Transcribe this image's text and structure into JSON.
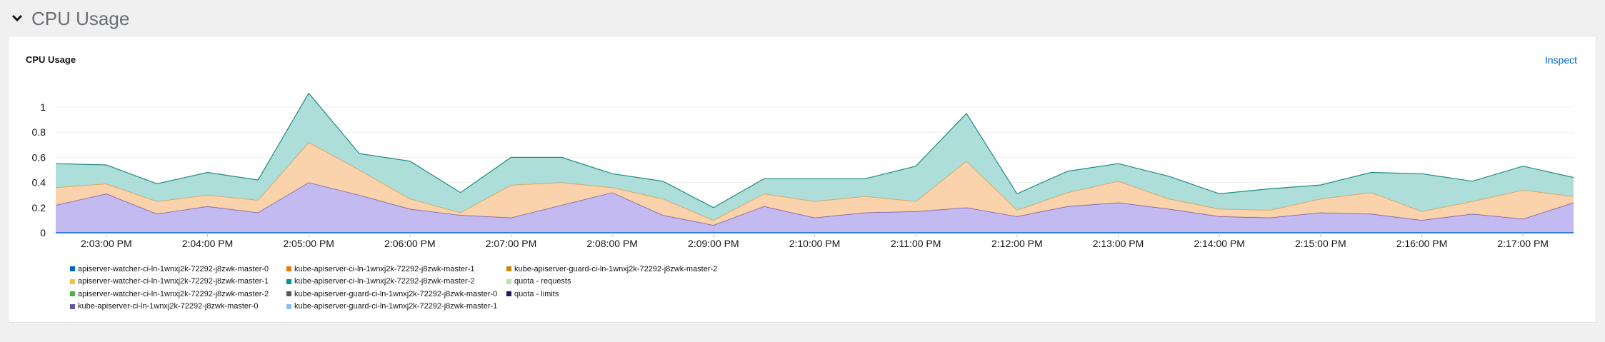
{
  "section": {
    "title": "CPU Usage"
  },
  "card": {
    "title": "CPU Usage",
    "inspect_label": "Inspect"
  },
  "chart_data": {
    "type": "area",
    "stacked": true,
    "x": [
      "14:02:30",
      "14:03:00",
      "14:03:30",
      "14:04:00",
      "14:04:30",
      "14:05:00",
      "14:05:30",
      "14:06:00",
      "14:06:30",
      "14:07:00",
      "14:07:30",
      "14:08:00",
      "14:08:30",
      "14:09:00",
      "14:09:30",
      "14:10:00",
      "14:10:30",
      "14:11:00",
      "14:11:30",
      "14:12:00",
      "14:12:30",
      "14:13:00",
      "14:13:30",
      "14:14:00",
      "14:14:30",
      "14:15:00",
      "14:15:30",
      "14:16:00",
      "14:16:30",
      "14:17:00",
      "14:17:30"
    ],
    "series": [
      {
        "name": "kube-apiserver-ci-ln-1wnxj2k-72292-j8zwk-master-0",
        "color": "#b8aeee",
        "stroke": "#6753ac",
        "values": [
          0.22,
          0.31,
          0.15,
          0.21,
          0.16,
          0.4,
          0.3,
          0.19,
          0.14,
          0.12,
          0.22,
          0.32,
          0.14,
          0.06,
          0.21,
          0.12,
          0.16,
          0.17,
          0.2,
          0.13,
          0.21,
          0.24,
          0.19,
          0.13,
          0.12,
          0.16,
          0.15,
          0.1,
          0.15,
          0.11,
          0.24
        ]
      },
      {
        "name": "kube-apiserver-ci-ln-1wnxj2k-72292-j8zwk-master-1",
        "color": "#f9ca9c",
        "stroke": "#e59b44",
        "values": [
          0.14,
          0.08,
          0.1,
          0.09,
          0.1,
          0.32,
          0.2,
          0.08,
          0.02,
          0.26,
          0.18,
          0.04,
          0.13,
          0.04,
          0.1,
          0.13,
          0.13,
          0.08,
          0.37,
          0.05,
          0.11,
          0.17,
          0.08,
          0.06,
          0.06,
          0.11,
          0.17,
          0.07,
          0.1,
          0.23,
          0.05
        ]
      },
      {
        "name": "kube-apiserver-ci-ln-1wnxj2k-72292-j8zwk-master-2",
        "color": "#9fd8d4",
        "stroke": "#1f8b85",
        "values": [
          0.19,
          0.15,
          0.14,
          0.18,
          0.16,
          0.39,
          0.13,
          0.3,
          0.16,
          0.22,
          0.2,
          0.11,
          0.14,
          0.1,
          0.12,
          0.18,
          0.14,
          0.28,
          0.38,
          0.13,
          0.17,
          0.14,
          0.18,
          0.12,
          0.17,
          0.11,
          0.16,
          0.3,
          0.16,
          0.19,
          0.15
        ]
      }
    ],
    "yticks": [
      "0",
      "0.2",
      "0.4",
      "0.6",
      "0.8",
      "1"
    ],
    "ylim": [
      0,
      1.12
    ],
    "xticks": [
      "2:03:00 PM",
      "2:04:00 PM",
      "2:05:00 PM",
      "2:06:00 PM",
      "2:07:00 PM",
      "2:08:00 PM",
      "2:09:00 PM",
      "2:10:00 PM",
      "2:11:00 PM",
      "2:12:00 PM",
      "2:13:00 PM",
      "2:14:00 PM",
      "2:15:00 PM",
      "2:16:00 PM",
      "2:17:00 PM"
    ],
    "xtick_positions": [
      "14:03:00",
      "14:04:00",
      "14:05:00",
      "14:06:00",
      "14:07:00",
      "14:08:00",
      "14:09:00",
      "14:10:00",
      "14:11:00",
      "14:12:00",
      "14:13:00",
      "14:14:00",
      "14:15:00",
      "14:16:00",
      "14:17:00"
    ],
    "xlim": [
      "14:02:30",
      "14:17:30"
    ],
    "grid": true,
    "legend": [
      {
        "label": "apiserver-watcher-ci-ln-1wnxj2k-72292-j8zwk-master-0",
        "color": "#0066cc"
      },
      {
        "label": "kube-apiserver-ci-ln-1wnxj2k-72292-j8zwk-master-1",
        "color": "#ec7a08"
      },
      {
        "label": "kube-apiserver-guard-ci-ln-1wnxj2k-72292-j8zwk-master-2",
        "color": "#c58c00"
      },
      {
        "label": "apiserver-watcher-ci-ln-1wnxj2k-72292-j8zwk-master-1",
        "color": "#f4c145"
      },
      {
        "label": "kube-apiserver-ci-ln-1wnxj2k-72292-j8zwk-master-2",
        "color": "#009596"
      },
      {
        "label": "quota - requests",
        "color": "#b6e2b0"
      },
      {
        "label": "apiserver-watcher-ci-ln-1wnxj2k-72292-j8zwk-master-2",
        "color": "#4cb140"
      },
      {
        "label": "kube-apiserver-guard-ci-ln-1wnxj2k-72292-j8zwk-master-0",
        "color": "#57595c"
      },
      {
        "label": "quota - limits",
        "color": "#1b1d5b"
      },
      {
        "label": "kube-apiserver-ci-ln-1wnxj2k-72292-j8zwk-master-0",
        "color": "#6753ac"
      },
      {
        "label": "kube-apiserver-guard-ci-ln-1wnxj2k-72292-j8zwk-master-1",
        "color": "#8bc1f7"
      }
    ]
  }
}
